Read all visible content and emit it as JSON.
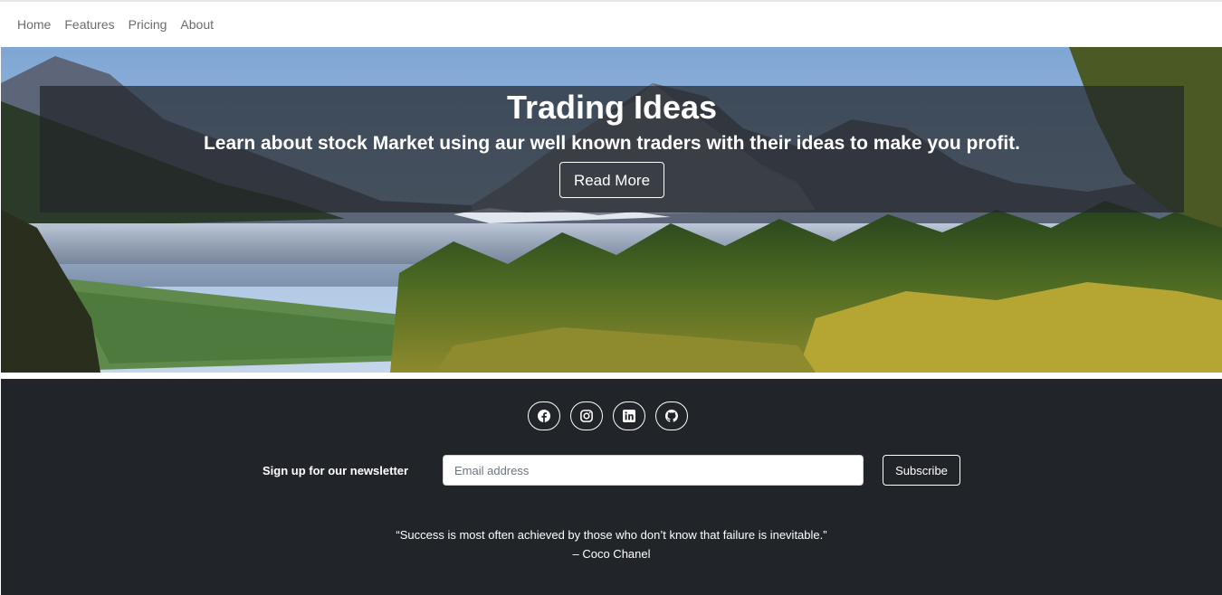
{
  "nav": {
    "items": [
      {
        "label": "Home"
      },
      {
        "label": "Features"
      },
      {
        "label": "Pricing"
      },
      {
        "label": "About"
      }
    ]
  },
  "hero": {
    "title": "Trading Ideas",
    "subtitle": "Learn about stock Market using aur well known traders with their ideas to make you profit.",
    "button_label": "Read More"
  },
  "footer": {
    "social_icons": [
      "facebook-icon",
      "instagram-icon",
      "linkedin-icon",
      "github-icon"
    ],
    "newsletter_label": "Sign up for our newsletter",
    "email_placeholder": "Email address",
    "email_value": "",
    "subscribe_label": "Subscribe",
    "quote_text": "“Success is most often achieved by those who don’t know that failure is inevitable.”",
    "quote_author": "– Coco Chanel"
  },
  "colors": {
    "footer_bg": "#212529",
    "nav_text": "#6c6c6c",
    "overlay": "rgba(33,37,41,0.72)"
  }
}
